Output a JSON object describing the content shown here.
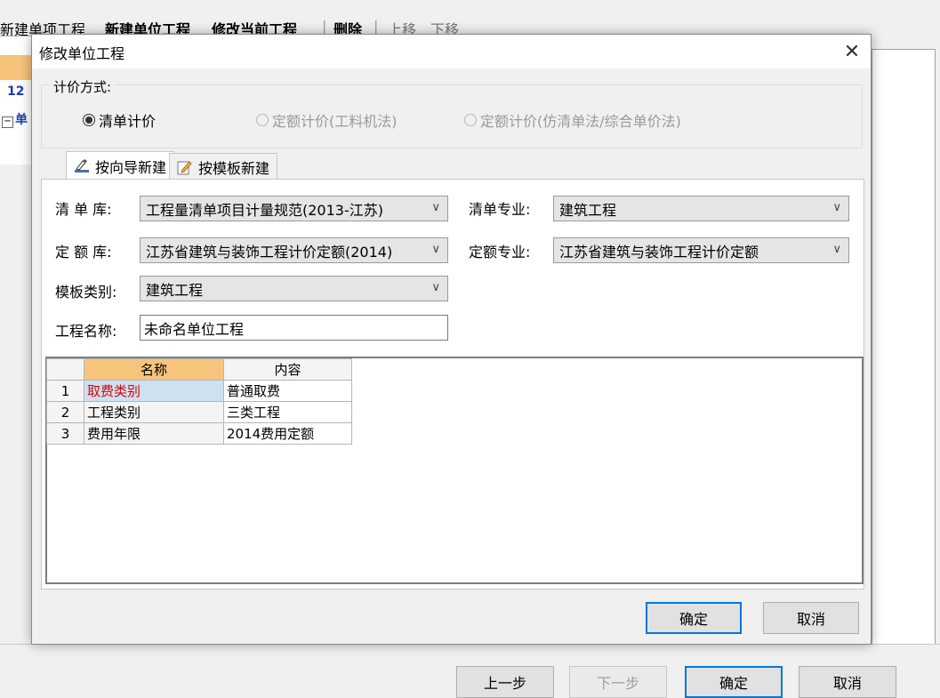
{
  "background": {
    "toolbar": [
      "新建单项工程",
      "新建单位工程",
      "修改当前工程",
      "|",
      "删除",
      "|",
      "上移",
      "下移"
    ],
    "tree_number": "12",
    "tree_item": "单",
    "buttons": {
      "prev": "上一步",
      "next": "下一步",
      "ok": "确定",
      "cancel": "取消"
    }
  },
  "dialog": {
    "title": "修改单位工程",
    "pricing": {
      "label": "计价方式:",
      "options": [
        {
          "label": "清单计价",
          "checked": true,
          "enabled": true
        },
        {
          "label": "定额计价(工料机法)",
          "checked": false,
          "enabled": false
        },
        {
          "label": "定额计价(仿清单法/综合单价法)",
          "checked": false,
          "enabled": false
        }
      ]
    },
    "tabs": [
      {
        "label": "按向导新建",
        "icon": "wizard-icon",
        "active": true
      },
      {
        "label": "按模板新建",
        "icon": "template-edit-icon",
        "active": false
      }
    ],
    "form": {
      "bill_lib_label": "清 单 库:",
      "bill_lib_value": "工程量清单项目计量规范(2013-江苏)",
      "bill_major_label": "清单专业:",
      "bill_major_value": "建筑工程",
      "quota_lib_label": "定 额 库:",
      "quota_lib_value": "江苏省建筑与装饰工程计价定额(2014)",
      "quota_major_label": "定额专业:",
      "quota_major_value": "江苏省建筑与装饰工程计价定额",
      "template_label": "模板类别:",
      "template_value": "建筑工程",
      "project_name_label": "工程名称:",
      "project_name_value": "未命名单位工程"
    },
    "grid": {
      "headers": [
        "名称",
        "内容"
      ],
      "rows": [
        {
          "num": "1",
          "name": "取费类别",
          "value": "普通取费"
        },
        {
          "num": "2",
          "name": "工程类别",
          "value": "三类工程"
        },
        {
          "num": "3",
          "name": "费用年限",
          "value": "2014费用定额"
        }
      ]
    },
    "buttons": {
      "ok": "确定",
      "cancel": "取消"
    }
  }
}
